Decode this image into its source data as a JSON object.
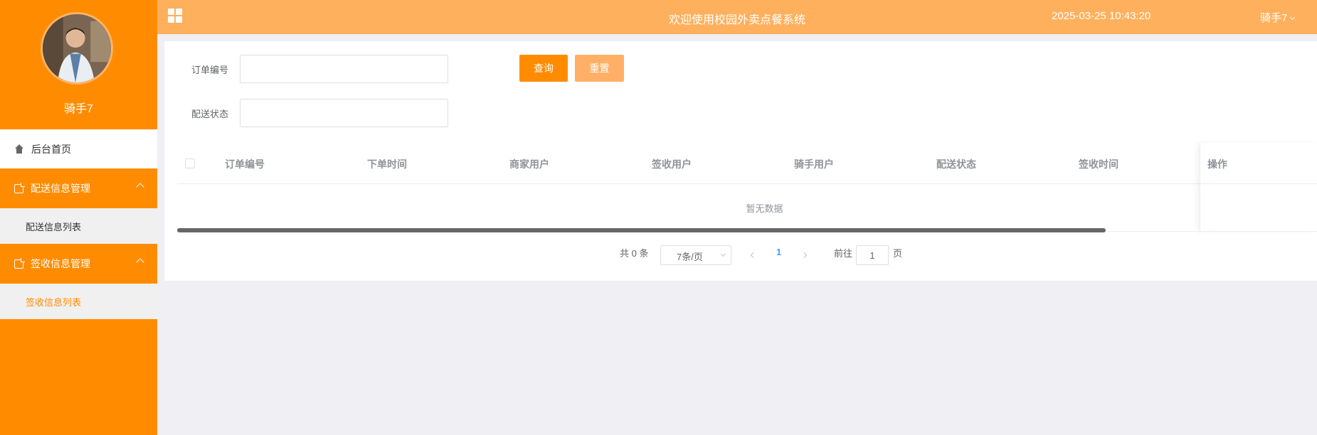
{
  "header": {
    "title": "欢迎使用校园外卖点餐系统",
    "datetime": "2025-03-25 10:43:20",
    "user": "骑手7"
  },
  "sidebar": {
    "username": "骑手7",
    "home": "后台首页",
    "groups": [
      {
        "label": "配送信息管理",
        "items": [
          "配送信息列表"
        ]
      },
      {
        "label": "签收信息管理",
        "items": [
          "签收信息列表"
        ]
      }
    ],
    "active_item": "签收信息列表"
  },
  "search": {
    "order_no_label": "订单编号",
    "order_no_value": "",
    "status_label": "配送状态",
    "status_value": "",
    "query_button": "查询",
    "reset_button": "重置"
  },
  "table": {
    "columns": [
      "订单编号",
      "下单时间",
      "商家用户",
      "签收用户",
      "骑手用户",
      "配送状态",
      "签收时间",
      "操作"
    ],
    "rows": [],
    "empty_text": "暂无数据"
  },
  "pagination": {
    "total_text": "共 0 条",
    "page_size": "7条/页",
    "current_page": "1",
    "goto_label": "前往",
    "goto_value": "1",
    "page_suffix": "页"
  },
  "colors": {
    "primary": "#ff8c00",
    "header": "#ffb05c",
    "reset": "#ffb066",
    "link": "#409eff"
  }
}
